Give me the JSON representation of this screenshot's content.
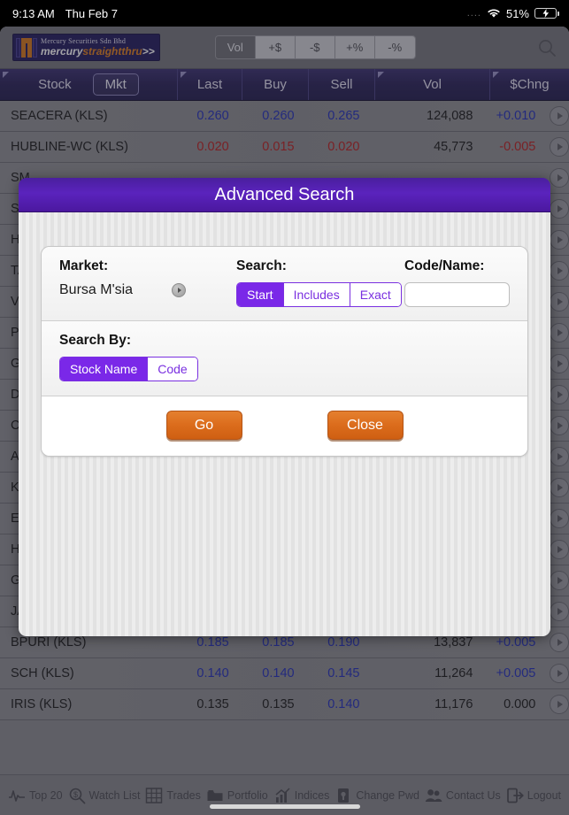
{
  "status_bar": {
    "time": "9:13 AM",
    "date": "Thu Feb 7",
    "dots": "....",
    "wifi_icon": "wifi-icon",
    "battery_percent": "51%",
    "battery_icon": "battery-charging-icon"
  },
  "toolbar": {
    "logo": {
      "company": "Mercury Securities Sdn Bhd",
      "brand_a": "mercury",
      "brand_b": "straightthru",
      "brand_c": ">>"
    },
    "filters": [
      {
        "label": "Vol",
        "selected": true
      },
      {
        "label": "+$",
        "selected": false
      },
      {
        "label": "-$",
        "selected": false
      },
      {
        "label": "+%",
        "selected": false
      },
      {
        "label": "-%",
        "selected": false
      }
    ],
    "search_icon": "search-icon"
  },
  "table": {
    "columns": [
      {
        "label": "Stock"
      },
      {
        "label": "Mkt"
      },
      {
        "label": "Last"
      },
      {
        "label": "Buy"
      },
      {
        "label": "Sell"
      },
      {
        "label": "Vol"
      },
      {
        "label": "$Chng"
      }
    ],
    "rows": [
      {
        "stock": "SEACERA (KLS)",
        "last": "0.260",
        "buy": "0.260",
        "sell": "0.265",
        "vol": "124,088",
        "chng": "+0.010",
        "tone": "blue"
      },
      {
        "stock": "HUBLINE-WC (KLS)",
        "last": "0.020",
        "buy": "0.015",
        "sell": "0.020",
        "vol": "45,773",
        "chng": "-0.005",
        "tone": "red"
      }
    ],
    "obscured_rows": [
      {
        "stock": "SM"
      },
      {
        "stock": "SA"
      },
      {
        "stock": "HU"
      },
      {
        "stock": "TAT"
      },
      {
        "stock": "VS"
      },
      {
        "stock": "PE"
      },
      {
        "stock": "GP"
      },
      {
        "stock": "DP"
      },
      {
        "stock": "CA"
      },
      {
        "stock": "AR"
      },
      {
        "stock": "KO"
      },
      {
        "stock": "EA"
      },
      {
        "stock": "HU"
      },
      {
        "stock": "GF"
      },
      {
        "stock": "JA"
      }
    ],
    "bottom_rows": [
      {
        "stock": "BPURI (KLS)",
        "last": "0.185",
        "buy": "0.185",
        "sell": "0.190",
        "vol": "13,837",
        "chng": "+0.005",
        "tone": "blue"
      },
      {
        "stock": "SCH (KLS)",
        "last": "0.140",
        "buy": "0.140",
        "sell": "0.145",
        "vol": "11,264",
        "chng": "+0.005",
        "tone": "blue"
      },
      {
        "stock": "IRIS (KLS)",
        "last": "0.135",
        "buy": "0.135",
        "sell": "0.140",
        "vol": "11,176",
        "chng": "0.000",
        "tone": "flat"
      }
    ]
  },
  "modal": {
    "title": "Advanced Search",
    "market": {
      "label": "Market:",
      "value": "Bursa M'sia",
      "disclosure_icon": "chevron-right-icon"
    },
    "search": {
      "label": "Search:",
      "options": [
        {
          "label": "Start",
          "selected": true
        },
        {
          "label": "Includes",
          "selected": false
        },
        {
          "label": "Exact",
          "selected": false
        }
      ]
    },
    "code_name": {
      "label": "Code/Name:",
      "value": "",
      "placeholder": ""
    },
    "search_by": {
      "label": "Search By:",
      "options": [
        {
          "label": "Stock Name",
          "selected": true
        },
        {
          "label": "Code",
          "selected": false
        }
      ]
    },
    "buttons": {
      "go": "Go",
      "close": "Close"
    }
  },
  "bottom_bar": {
    "items": [
      {
        "label": "Top 20",
        "icon": "pulse-icon"
      },
      {
        "label": "Watch List",
        "icon": "magnifier-dollar-icon"
      },
      {
        "label": "Trades",
        "icon": "grid-trades-icon"
      },
      {
        "label": "Portfolio",
        "icon": "folder-icon"
      },
      {
        "label": "Indices",
        "icon": "bar-chart-icon"
      },
      {
        "label": "Change Pwd",
        "icon": "lock-icon"
      },
      {
        "label": "Contact Us",
        "icon": "people-icon"
      },
      {
        "label": "Logout",
        "icon": "logout-icon"
      }
    ]
  },
  "colors": {
    "accent_purple": "#7a28e8",
    "header_navy": "#2a2258",
    "orange_button": "#db6c1c",
    "up_blue": "#2430b8",
    "down_red": "#b81f20"
  }
}
